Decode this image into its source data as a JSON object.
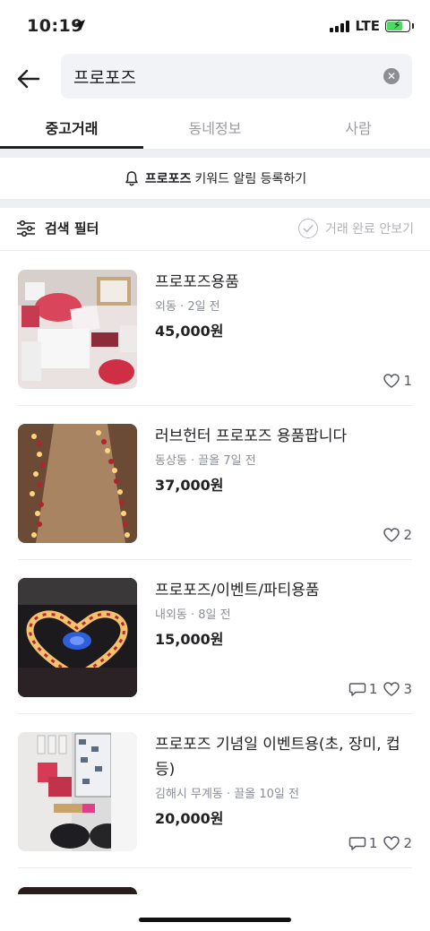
{
  "status": {
    "time": "10:19",
    "network": "LTE"
  },
  "search": {
    "query": "프로포즈"
  },
  "tabs": [
    {
      "label": "중고거래",
      "active": true
    },
    {
      "label": "동네정보",
      "active": false
    },
    {
      "label": "사람",
      "active": false
    }
  ],
  "keyword_alert": {
    "keyword": "프로포즈",
    "text": "키워드 알림 등록하기"
  },
  "filter": {
    "label": "검색 필터",
    "hide_done_label": "거래 완료 안보기"
  },
  "items": [
    {
      "title": "프로포즈용품",
      "meta": "외동 · 2일 전",
      "price": "45,000원",
      "chats": "",
      "likes": "1"
    },
    {
      "title": "러브헌터 프로포즈 용품팝니다",
      "meta": "동상동 · 끌올 7일 전",
      "price": "37,000원",
      "chats": "",
      "likes": "2"
    },
    {
      "title": "프로포즈/이벤트/파티용품",
      "meta": "내외동 · 8일 전",
      "price": "15,000원",
      "chats": "1",
      "likes": "3"
    },
    {
      "title": "프로포즈 기념일 이벤트용(초, 장미, 컵등)",
      "meta": "김해시 무계동 · 끌올 10일 전",
      "price": "20,000원",
      "chats": "1",
      "likes": "2"
    }
  ],
  "colors": {
    "accent": "#212124",
    "muted": "#8b8e95",
    "band": "#eeeff2"
  }
}
